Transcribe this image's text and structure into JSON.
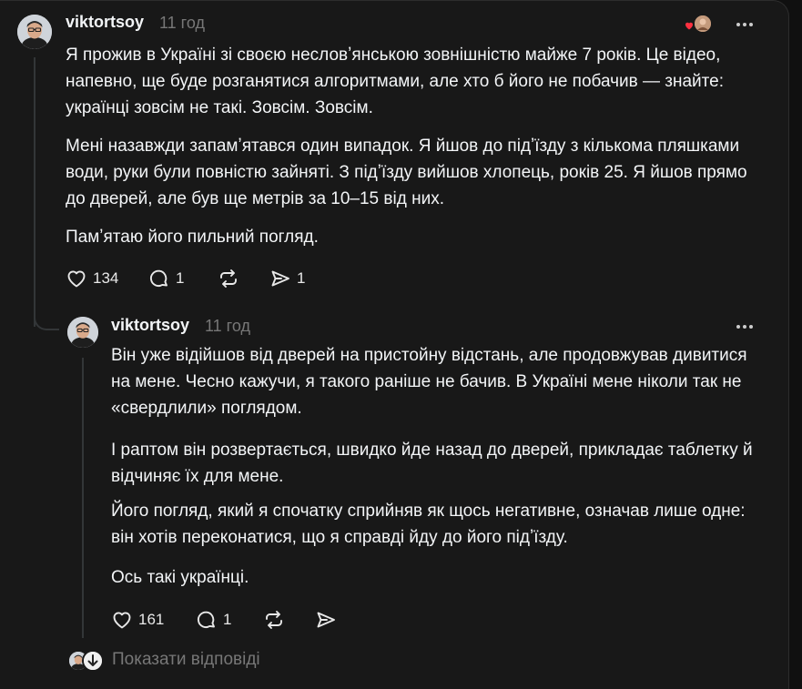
{
  "post": {
    "username": "viktortsoy",
    "time": "11 год",
    "paragraphs": [
      "Я прожив в Україні зі своєю несловʼянською зовнішністю майже 7 років. Це відео, напевно, ще буде розганятися алгоритмами, але хто б його не побачив — знайте: українці зовсім не такі. Зовсім. Зовсім.",
      "Мені назавжди запамʼятався один випадок. Я йшов до підʼїзду з кількома пляшками води, руки були повністю зайняті. З підʼїзду вийшов хлопець, років 25. Я йшов прямо до дверей, але був ще метрів за 10–15 від них.",
      "Памʼятаю його пильний погляд."
    ],
    "likes": "134",
    "replies": "1",
    "reposts": "",
    "shares": "1"
  },
  "reply": {
    "username": "viktortsoy",
    "time": "11 год",
    "paragraphs": [
      "Він уже відійшов від дверей на пристойну відстань, але продовжував дивитися на мене. Чесно кажучи, я такого раніше не бачив. В Україні мене ніколи так не «свердлили» поглядом.",
      "І раптом він розвертається, швидко йде назад до дверей, прикладає таблетку й відчиняє їх для мене.",
      "Його погляд, який я спочатку сприйняв як щось негативне, означав лише одне: він хотів переконатися, що я справді йду до його підʼїзду.",
      "Ось такі українці."
    ],
    "likes": "161",
    "replies": "1",
    "reposts": "",
    "shares": ""
  },
  "footer": {
    "show_replies": "Показати відповіді"
  },
  "icons": {
    "like": "heart-icon",
    "reply": "comment-icon",
    "repost": "repost-icon",
    "share": "share-icon",
    "more": "more-icon"
  },
  "colors": {
    "background": "#101010",
    "card": "#181818",
    "text": "#f3f5f7",
    "muted": "#777777",
    "heart": "#ff3040"
  }
}
